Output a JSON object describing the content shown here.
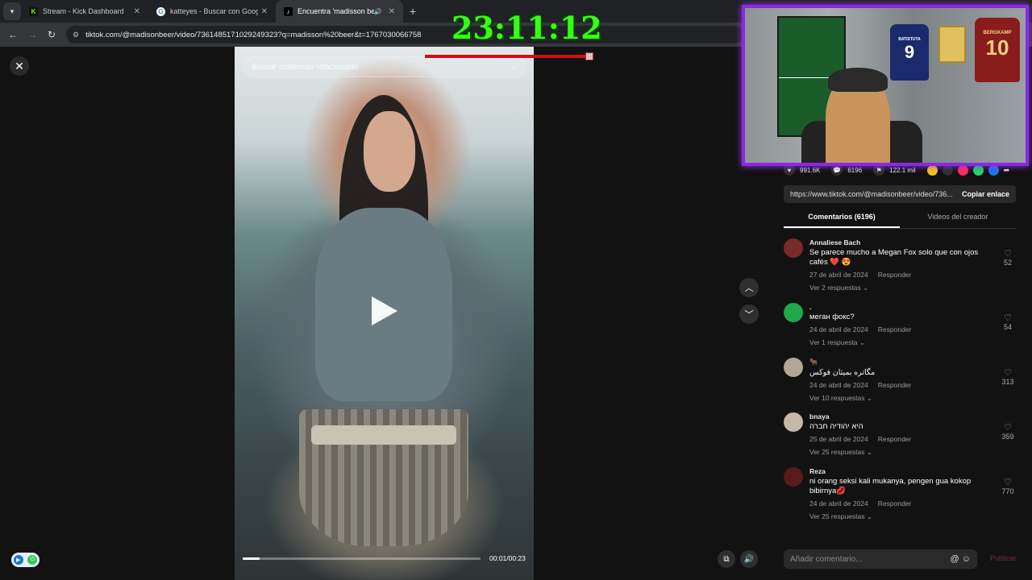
{
  "browser": {
    "tabs": [
      {
        "title": "Stream - Kick Dashboard",
        "favicon": "K",
        "color": "#53fc18"
      },
      {
        "title": "katteyes - Buscar con Google",
        "favicon": "G",
        "color": "#ffffff"
      },
      {
        "title": "Encuentra 'madisson beer'",
        "favicon": "♪",
        "color": "#000000",
        "active": true
      }
    ],
    "url": "tiktok.com/@madisonbeer/video/7361485171029249323?q=madisson%20beer&t=1767030066758"
  },
  "overlay": {
    "timer": "23:11:12"
  },
  "video": {
    "search_placeholder": "Buscar contenido relacionado",
    "timecode": "00:01/00:23",
    "progress": 0.07
  },
  "panel": {
    "stats": {
      "likes": "991.6K",
      "comments": "6196",
      "saves": "122.1 mil"
    },
    "share_colors": [
      "#f5c518",
      "#2e2e2e",
      "#fe2c55",
      "#25d366",
      "#1877f2"
    ],
    "copy_url": "https://www.tiktok.com/@madisonbeer/video/736...",
    "copy_button": "Copiar enlace",
    "tabs": {
      "comments": "Comentarios (6196)",
      "creator_videos": "Videos del creador"
    },
    "reply_label": "Responder",
    "comments": [
      {
        "name": "Annaliese Bach",
        "text": "Se parece mucho a Megan Fox solo que con ojos cafés ❤️ 😍",
        "date": "27 de abril de 2024",
        "replies": "Ver 2 respuestas",
        "likes": "52",
        "avatar_color": "#7a2a2a"
      },
      {
        "name": ".",
        "text": "меган фокс?",
        "date": "24 de abril de 2024",
        "replies": "Ver 1 respuesta",
        "likes": "54",
        "avatar_color": "#1fa84a"
      },
      {
        "name": "🐂",
        "text": "مگاتره بميتان فوكس",
        "date": "24 de abril de 2024",
        "replies": "Ver 10 respuestas",
        "likes": "313",
        "avatar_color": "#b0a890"
      },
      {
        "name": "bnaya",
        "text": "היא יהודיה חברה",
        "date": "25 de abril de 2024",
        "replies": "Ver 25 respuestas",
        "likes": "359",
        "avatar_color": "#c8b8a8"
      },
      {
        "name": "Reza",
        "text": "ni orang seksi kali mukanya, pengen gua kokop bibirnya💋",
        "date": "24 de abril de 2024",
        "replies": "Ver 25 respuestas",
        "likes": "770",
        "avatar_color": "#5a1a1a"
      }
    ],
    "add_comment_placeholder": "Añadir comentario...",
    "publish": "Publicar"
  },
  "webcam": {
    "shirt_numbers": [
      "9",
      "10"
    ],
    "shirt_names": [
      "BATISTUTA",
      "BERGKAMP"
    ]
  }
}
